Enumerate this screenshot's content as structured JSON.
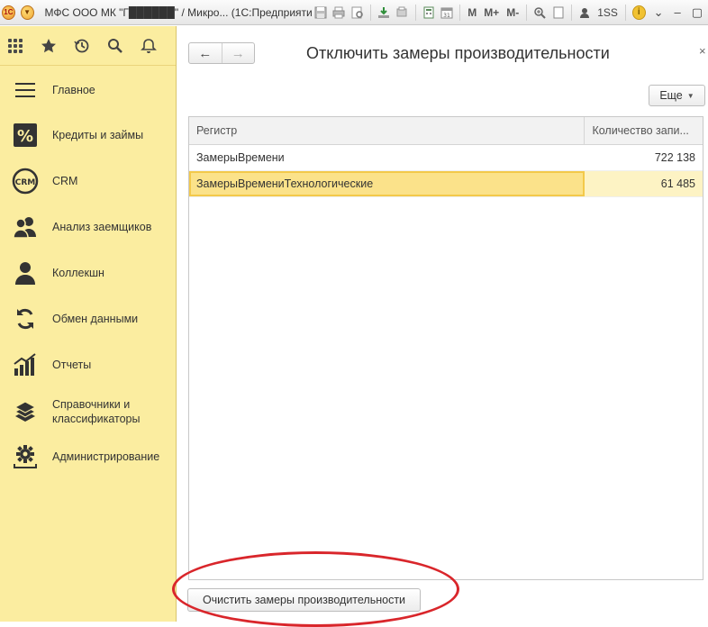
{
  "titlebar": {
    "app_logo": "1C",
    "window_title": "МФС ООО МК \"Г██████\" / Микро... (1С:Предприятие)",
    "m_label": "M",
    "m_plus_label": "M+",
    "m_minus_label": "M-",
    "user": "1SS",
    "icons": [
      "save-icon",
      "print-icon",
      "print-preview-icon",
      "download-icon",
      "print-doc-icon",
      "calculator-icon",
      "calendar-icon",
      "zoom-icon",
      "window-icon",
      "user-icon",
      "info-icon",
      "minimize-icon",
      "restore-icon",
      "close-icon"
    ]
  },
  "sidebar": {
    "toolbar_icons": [
      "apps-grid-icon",
      "star-icon",
      "history-icon",
      "search-icon",
      "bell-icon"
    ],
    "items": [
      {
        "label": "Главное",
        "icon": "menu-lines-icon"
      },
      {
        "label": "Кредиты и займы",
        "icon": "percent-icon"
      },
      {
        "label": "CRM",
        "icon": "crm-icon"
      },
      {
        "label": "Анализ заемщиков",
        "icon": "users-icon"
      },
      {
        "label": "Коллекшн",
        "icon": "user-icon"
      },
      {
        "label": "Обмен данными",
        "icon": "sync-icon"
      },
      {
        "label": "Отчеты",
        "icon": "bar-chart-icon"
      },
      {
        "label": "Справочники и\nклассификаторы",
        "icon": "books-icon"
      },
      {
        "label": "Администрирование",
        "icon": "gear-icon"
      }
    ]
  },
  "main": {
    "back_icon": "←",
    "forward_icon": "→",
    "title": "Отключить замеры производительности",
    "close": "×",
    "more_button": "Еще",
    "table": {
      "columns": [
        "Регистр",
        "Количество запи..."
      ],
      "rows": [
        {
          "register": "ЗамерыВремени",
          "count": "722 138",
          "selected": false
        },
        {
          "register": "ЗамерыВремениТехнологические",
          "count": "61 485",
          "selected": true
        }
      ]
    },
    "clear_button": "Очистить замеры производительности"
  },
  "colors": {
    "sidebar_bg": "#fbeda0",
    "selection": "#fbe28a",
    "annotation_ellipse": "#d9262b"
  }
}
